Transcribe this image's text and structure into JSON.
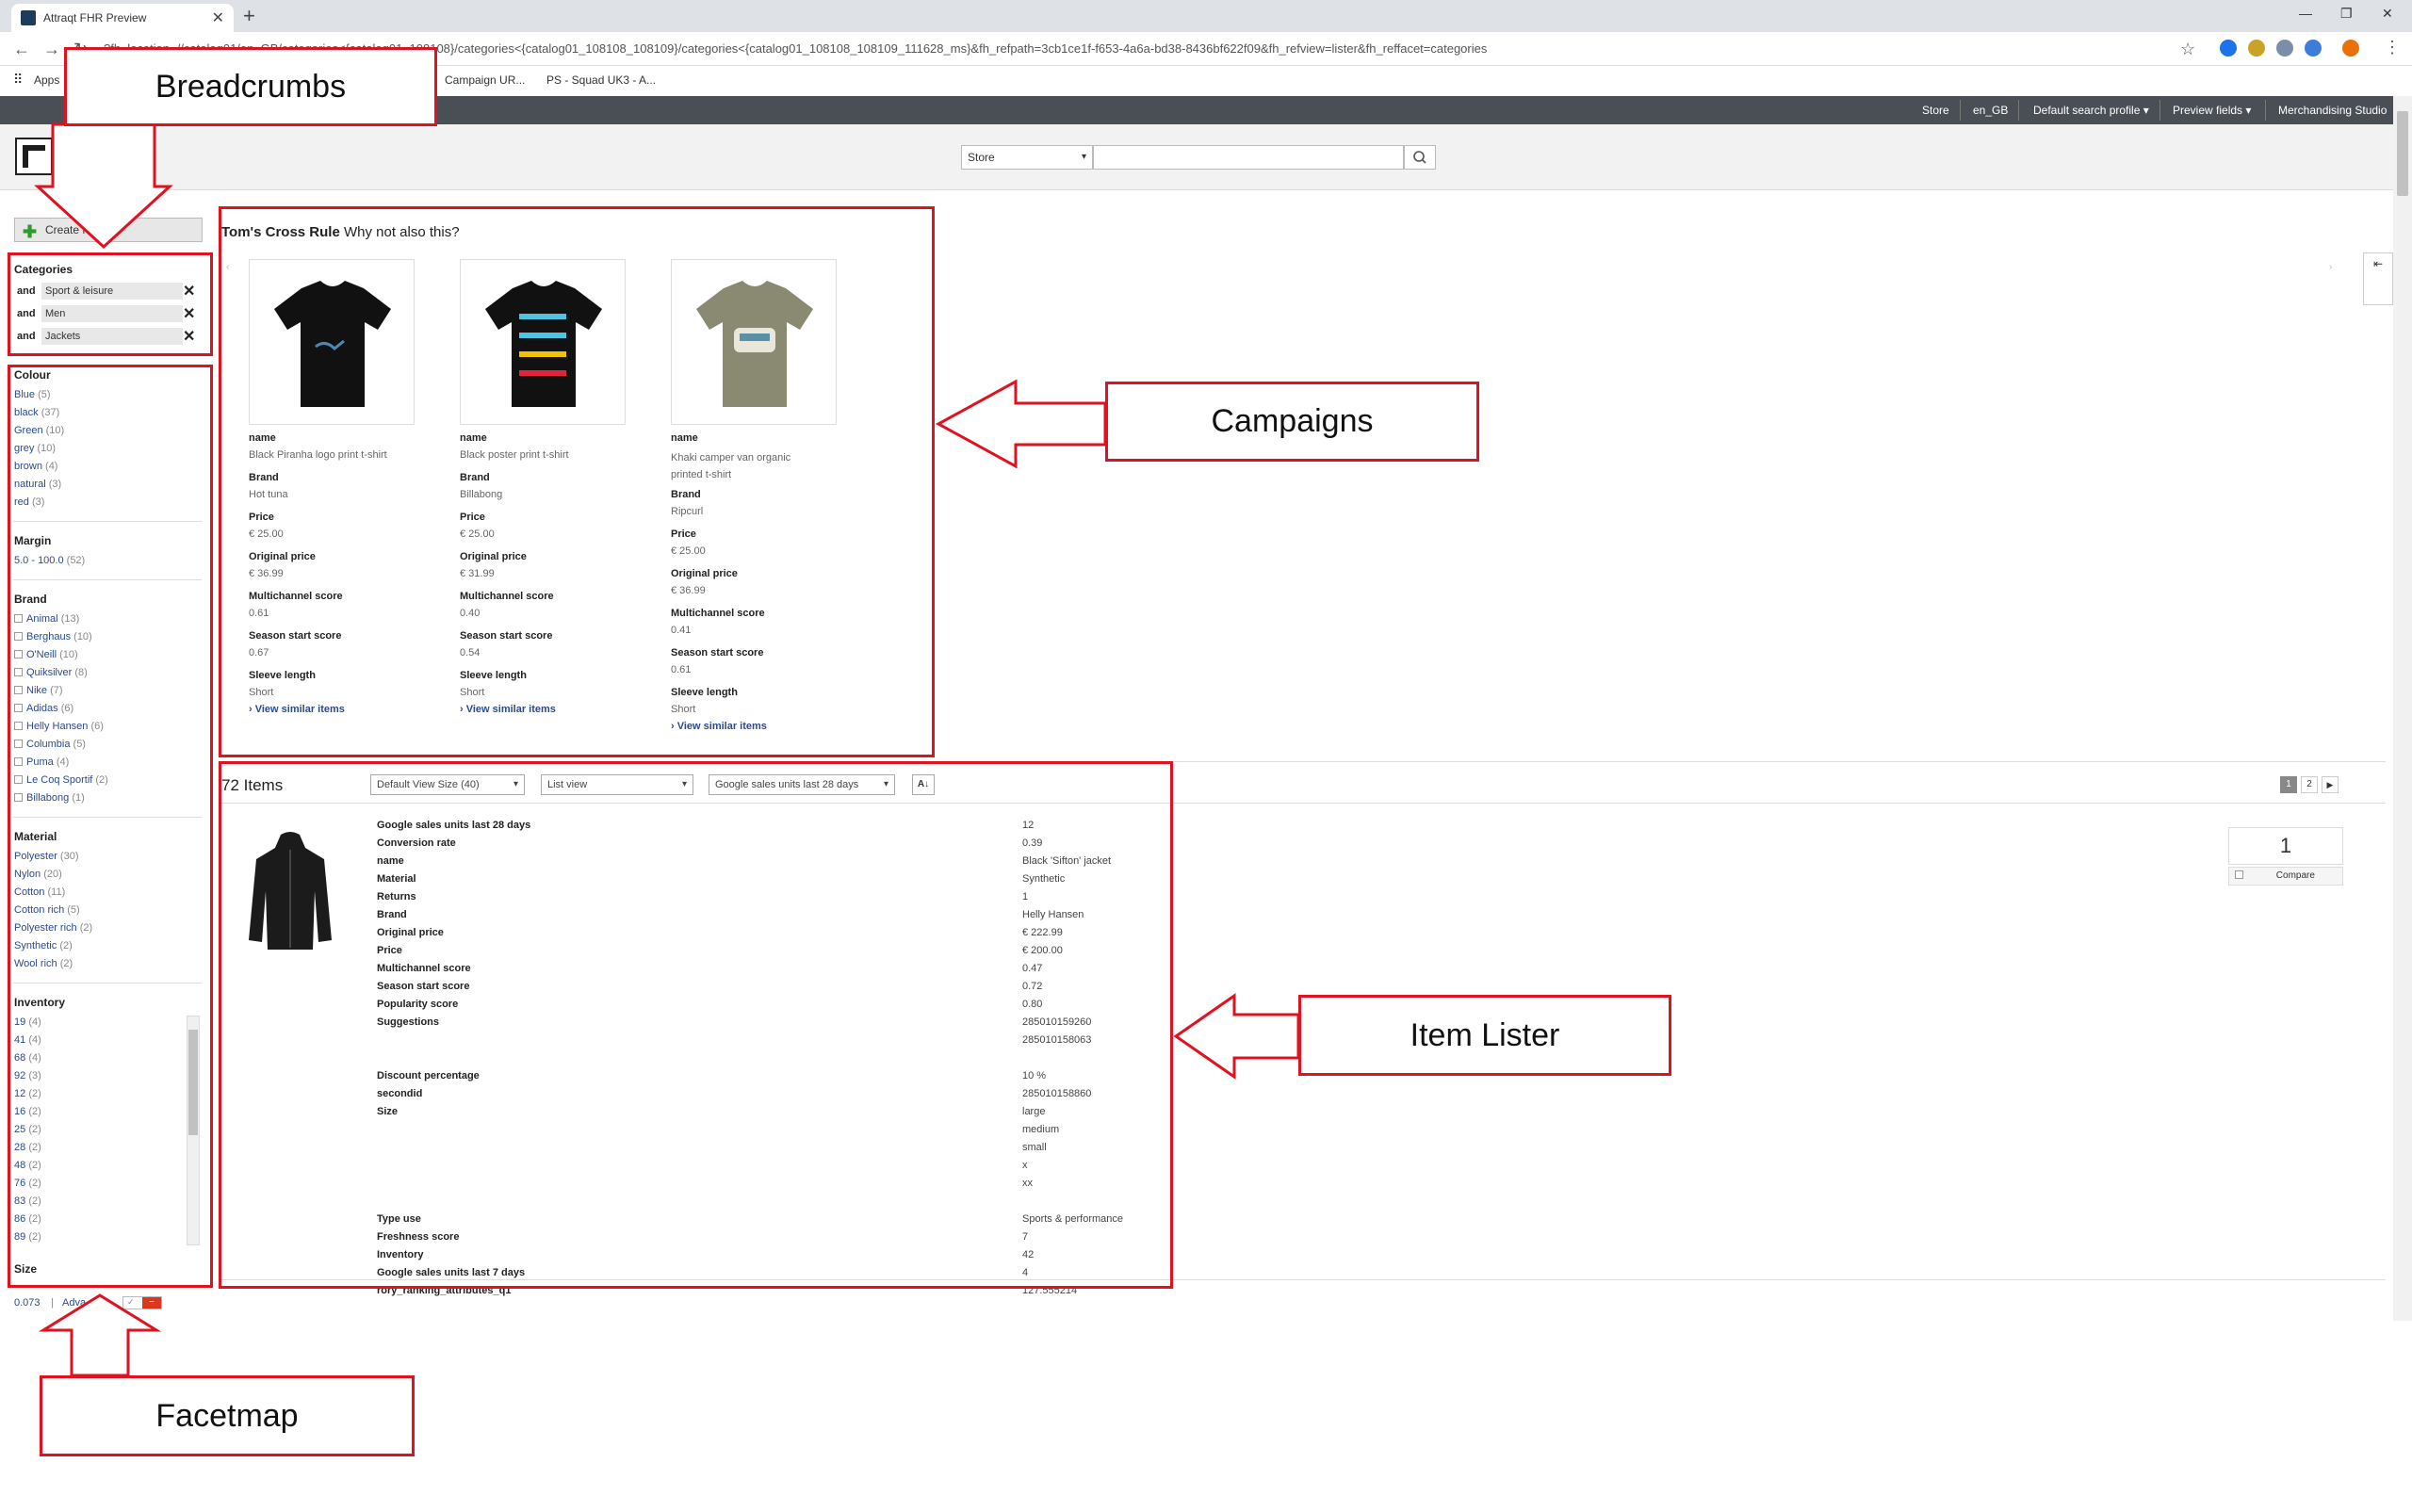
{
  "browser": {
    "tab_title": "Attraqt FHR Preview",
    "url": "?fh_location=//catalog01/en_GB/categories<{catalog01_108108}/categories<{catalog01_108108_108109}/categories<{catalog01_108108_108109_111628_ms}&fh_refpath=3cb1ce1f-f653-4a6a-bd38-8436bf622f09&fh_refview=lister&fh_reffacet=categories",
    "bookmarks": [
      "Apps",
      "Campaign UR...",
      "PS - Squad UK3 - A..."
    ]
  },
  "fh_topbar": {
    "items": [
      "Store",
      "en_GB",
      "Default search profile ▾",
      "Preview fields ▾",
      "Merchandising Studio"
    ]
  },
  "header": {
    "logo_text": "FH",
    "store_select": "Store",
    "search_placeholder": ""
  },
  "sidebar": {
    "create_new": "Create Ne...",
    "categories_title": "Categories",
    "breadcrumbs": [
      {
        "op": "and",
        "value": "Sport & leisure"
      },
      {
        "op": "and",
        "value": "Men"
      },
      {
        "op": "and",
        "value": "Jackets"
      }
    ],
    "facets": {
      "colour": {
        "title": "Colour",
        "items": [
          {
            "label": "Blue",
            "count": "(5)"
          },
          {
            "label": "black",
            "count": "(37)"
          },
          {
            "label": "Green",
            "count": "(10)"
          },
          {
            "label": "grey",
            "count": "(10)"
          },
          {
            "label": "brown",
            "count": "(4)"
          },
          {
            "label": "natural",
            "count": "(3)"
          },
          {
            "label": "red",
            "count": "(3)"
          }
        ]
      },
      "margin": {
        "title": "Margin",
        "items": [
          {
            "label": "5.0 - 100.0",
            "count": "(52)"
          }
        ]
      },
      "brand": {
        "title": "Brand",
        "items": [
          {
            "label": "Animal",
            "count": "(13)"
          },
          {
            "label": "Berghaus",
            "count": "(10)"
          },
          {
            "label": "O'Neill",
            "count": "(10)"
          },
          {
            "label": "Quiksilver",
            "count": "(8)"
          },
          {
            "label": "Nike",
            "count": "(7)"
          },
          {
            "label": "Adidas",
            "count": "(6)"
          },
          {
            "label": "Helly Hansen",
            "count": "(6)"
          },
          {
            "label": "Columbia",
            "count": "(5)"
          },
          {
            "label": "Puma",
            "count": "(4)"
          },
          {
            "label": "Le Coq Sportif",
            "count": "(2)"
          },
          {
            "label": "Billabong",
            "count": "(1)"
          }
        ]
      },
      "material": {
        "title": "Material",
        "items": [
          {
            "label": "Polyester",
            "count": "(30)"
          },
          {
            "label": "Nylon",
            "count": "(20)"
          },
          {
            "label": "Cotton",
            "count": "(11)"
          },
          {
            "label": "Cotton rich",
            "count": "(5)"
          },
          {
            "label": "Polyester rich",
            "count": "(2)"
          },
          {
            "label": "Synthetic",
            "count": "(2)"
          },
          {
            "label": "Wool rich",
            "count": "(2)"
          }
        ]
      },
      "inventory": {
        "title": "Inventory",
        "items": [
          {
            "label": "19",
            "count": "(4)"
          },
          {
            "label": "41",
            "count": "(4)"
          },
          {
            "label": "68",
            "count": "(4)"
          },
          {
            "label": "92",
            "count": "(3)"
          },
          {
            "label": "12",
            "count": "(2)"
          },
          {
            "label": "16",
            "count": "(2)"
          },
          {
            "label": "25",
            "count": "(2)"
          },
          {
            "label": "28",
            "count": "(2)"
          },
          {
            "label": "48",
            "count": "(2)"
          },
          {
            "label": "76",
            "count": "(2)"
          },
          {
            "label": "83",
            "count": "(2)"
          },
          {
            "label": "86",
            "count": "(2)"
          },
          {
            "label": "89",
            "count": "(2)"
          }
        ]
      },
      "size": {
        "title": "Size"
      }
    },
    "footer": {
      "time": "0.073",
      "sep": "|",
      "advanced": "Adva..."
    }
  },
  "annotations": {
    "breadcrumbs": "Breadcrumbs",
    "campaigns": "Campaigns",
    "item_lister": "Item Lister",
    "facetmap": "Facetmap"
  },
  "campaign": {
    "title_bold": "Tom's Cross Rule",
    "title_rest": "Why not also this?",
    "products": [
      {
        "name_label": "name",
        "name": "Black Piranha logo print t-shirt",
        "brand_label": "Brand",
        "brand": "Hot tuna",
        "price_label": "Price",
        "price": "€ 25.00",
        "orig_label": "Original price",
        "orig": "€ 36.99",
        "multi_label": "Multichannel score",
        "multi": "0.61",
        "season_label": "Season start score",
        "season": "0.67",
        "sleeve_label": "Sleeve length",
        "sleeve": "Short",
        "link": "View similar items",
        "shirt_color": "#111111"
      },
      {
        "name_label": "name",
        "name": "Black poster print t-shirt",
        "brand_label": "Brand",
        "brand": "Billabong",
        "price_label": "Price",
        "price": "€ 25.00",
        "orig_label": "Original price",
        "orig": "€ 31.99",
        "multi_label": "Multichannel score",
        "multi": "0.40",
        "season_label": "Season start score",
        "season": "0.54",
        "sleeve_label": "Sleeve length",
        "sleeve": "Short",
        "link": "View similar items",
        "shirt_color": "#111111"
      },
      {
        "name_label": "name",
        "name": "Khaki camper van organic printed t-shirt",
        "brand_label": "Brand",
        "brand": "Ripcurl",
        "price_label": "Price",
        "price": "€ 25.00",
        "orig_label": "Original price",
        "orig": "€ 36.99",
        "multi_label": "Multichannel score",
        "multi": "0.41",
        "season_label": "Season start score",
        "season": "0.61",
        "sleeve_label": "Sleeve length",
        "sleeve": "Short",
        "link": "View similar items",
        "shirt_color": "#8a8a72"
      }
    ]
  },
  "lister": {
    "count": "72 Items",
    "view_size": "Default View Size (40)",
    "view_mode": "List view",
    "sort": "Google sales units last 28 days",
    "pages": [
      "1",
      "2"
    ],
    "compare_count": "1",
    "compare_label": "Compare",
    "attributes": [
      {
        "label": "Google sales units last 28 days",
        "values": [
          "12"
        ]
      },
      {
        "label": "Conversion rate",
        "values": [
          "0.39"
        ]
      },
      {
        "label": "name",
        "values": [
          "Black 'Sifton' jacket"
        ]
      },
      {
        "label": "Material",
        "values": [
          "Synthetic"
        ]
      },
      {
        "label": "Returns",
        "values": [
          "1"
        ]
      },
      {
        "label": "Brand",
        "values": [
          "Helly Hansen"
        ]
      },
      {
        "label": "Original price",
        "values": [
          "€ 222.99"
        ]
      },
      {
        "label": "Price",
        "values": [
          "€ 200.00"
        ]
      },
      {
        "label": "Multichannel score",
        "values": [
          "0.47"
        ]
      },
      {
        "label": "Season start score",
        "values": [
          "0.72"
        ]
      },
      {
        "label": "Popularity score",
        "values": [
          "0.80"
        ]
      },
      {
        "label": "Suggestions",
        "values": [
          "285010159260",
          "285010158063",
          ""
        ]
      },
      {
        "label": "Discount percentage",
        "values": [
          "10 %"
        ]
      },
      {
        "label": "secondid",
        "values": [
          "285010158860"
        ]
      },
      {
        "label": "Size",
        "values": [
          "large",
          "medium",
          "small",
          "x",
          "xx",
          ""
        ]
      },
      {
        "label": "Type use",
        "values": [
          "Sports & performance"
        ]
      },
      {
        "label": "Freshness score",
        "values": [
          "7"
        ]
      },
      {
        "label": "Inventory",
        "values": [
          "42"
        ]
      },
      {
        "label": "Google sales units last 7 days",
        "values": [
          "4"
        ]
      },
      {
        "label": "rory_ranking_attributes_q1",
        "values": [
          "127.555214"
        ]
      }
    ]
  },
  "colors": {
    "annotation_red": "#e0121f",
    "fh_dark": "#4a4f56",
    "link_blue": "#2b4a8e"
  }
}
